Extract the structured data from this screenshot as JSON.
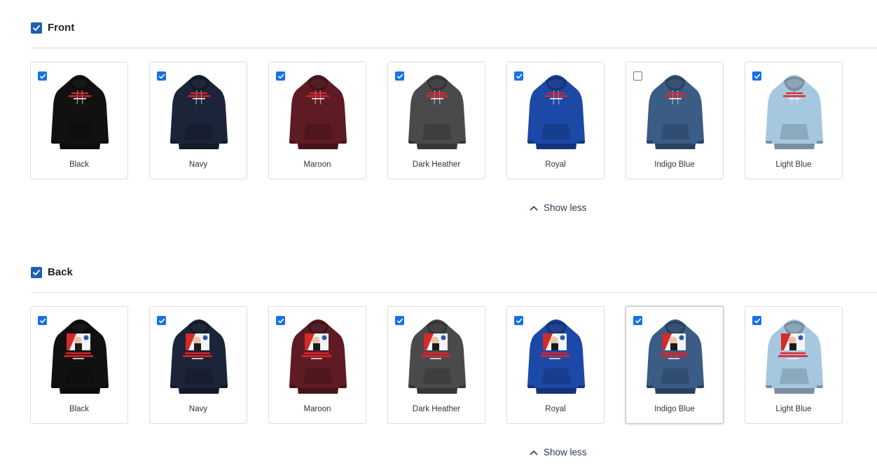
{
  "front": {
    "title": "Front",
    "checked": true,
    "show_less_label": "Show less",
    "variants": [
      {
        "name": "Black",
        "color": "#111111",
        "checked": true
      },
      {
        "name": "Navy",
        "color": "#1b2438",
        "checked": true
      },
      {
        "name": "Maroon",
        "color": "#5e1b24",
        "checked": true
      },
      {
        "name": "Dark Heather",
        "color": "#4a4a4c",
        "checked": true
      },
      {
        "name": "Royal",
        "color": "#1c48a8",
        "checked": true
      },
      {
        "name": "Indigo Blue",
        "color": "#3a5c85",
        "checked": false
      },
      {
        "name": "Light Blue",
        "color": "#a6c7e0",
        "checked": true
      }
    ]
  },
  "back": {
    "title": "Back",
    "checked": true,
    "show_less_label": "Show less",
    "variants": [
      {
        "name": "Black",
        "color": "#111111",
        "checked": true
      },
      {
        "name": "Navy",
        "color": "#1b2438",
        "checked": true
      },
      {
        "name": "Maroon",
        "color": "#5e1b24",
        "checked": true
      },
      {
        "name": "Dark Heather",
        "color": "#4a4a4c",
        "checked": true
      },
      {
        "name": "Royal",
        "color": "#1c48a8",
        "checked": true
      },
      {
        "name": "Indigo Blue",
        "color": "#3a5c85",
        "checked": true,
        "hovered": true
      },
      {
        "name": "Light Blue",
        "color": "#a6c7e0",
        "checked": true
      }
    ]
  }
}
